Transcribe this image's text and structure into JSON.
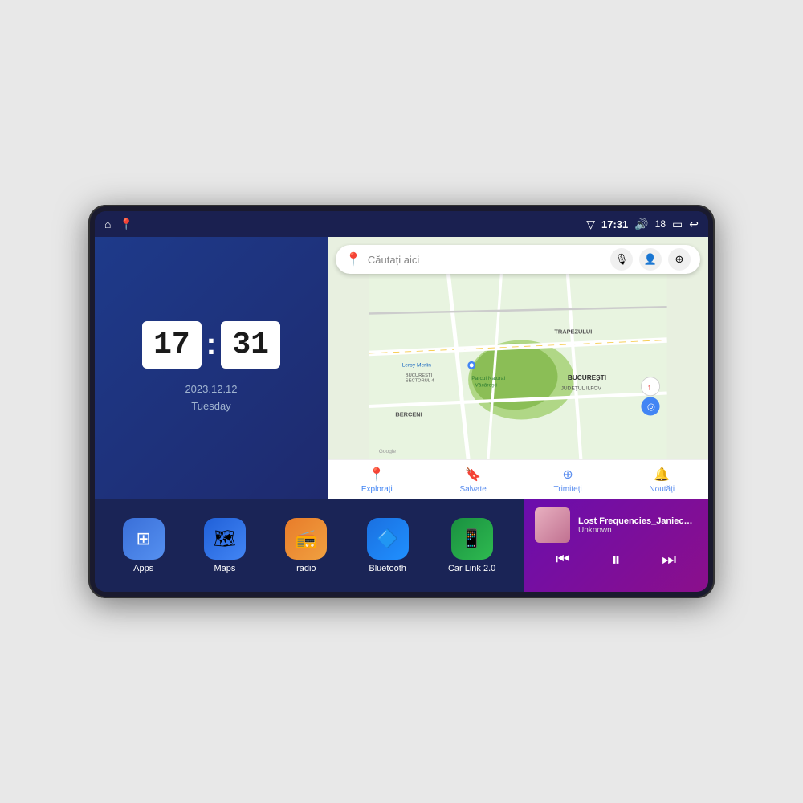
{
  "device": {
    "status_bar": {
      "time": "17:31",
      "signal_icon": "▽",
      "volume_icon": "🔊",
      "battery_level": "18",
      "battery_icon": "▭",
      "back_icon": "↩",
      "home_icon": "⌂",
      "maps_icon": "📍"
    },
    "clock": {
      "hours": "17",
      "minutes": "31",
      "date": "2023.12.12",
      "day": "Tuesday"
    },
    "map": {
      "search_placeholder": "Căutați aici",
      "nav_items": [
        {
          "label": "Explorați",
          "icon": "📍",
          "active": true
        },
        {
          "label": "Salvate",
          "icon": "🔖",
          "active": false
        },
        {
          "label": "Trimiteți",
          "icon": "⊕",
          "active": false
        },
        {
          "label": "Noutăți",
          "icon": "🔔",
          "active": false
        }
      ],
      "labels": {
        "trapezului": "TRAPEZULUI",
        "bucuresti": "BUCUREȘTI",
        "judetul": "JUDEȚUL ILFOV",
        "berceni": "BERCENI",
        "parcul": "Parcul Natural Văcărești",
        "leroy": "Leroy Merlin",
        "sector4": "BUCUREȘTI SECTORUL 4",
        "google": "Google"
      }
    },
    "apps": [
      {
        "id": "apps",
        "label": "Apps",
        "icon": "⊞",
        "bg": "#3a6fd8"
      },
      {
        "id": "maps",
        "label": "Maps",
        "icon": "🗺",
        "bg": "#4285f4"
      },
      {
        "id": "radio",
        "label": "radio",
        "icon": "📻",
        "bg": "#e87c2a"
      },
      {
        "id": "bluetooth",
        "label": "Bluetooth",
        "icon": "🔷",
        "bg": "#1e90ff"
      },
      {
        "id": "carlink",
        "label": "Car Link 2.0",
        "icon": "📱",
        "bg": "#2ea84d"
      }
    ],
    "music": {
      "title": "Lost Frequencies_Janieck Devy-...",
      "artist": "Unknown",
      "prev_icon": "⏮",
      "play_icon": "⏸",
      "next_icon": "⏭"
    }
  }
}
